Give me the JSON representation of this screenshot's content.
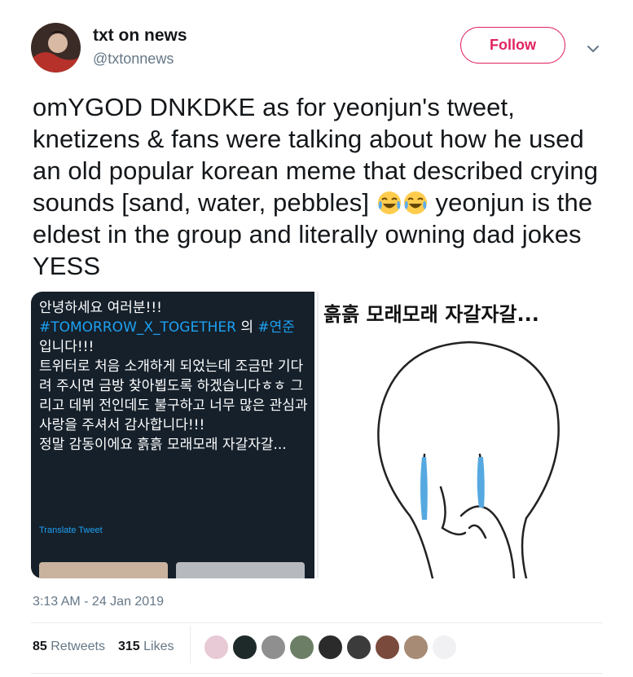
{
  "user": {
    "display_name": "txt on news",
    "handle": "@txtonnews",
    "avatar_colors": [
      "#3b2b26",
      "#d8b9a4",
      "#b5312a"
    ]
  },
  "follow_label": "Follow",
  "tweet": {
    "text_before_emoji": "omYGOD DNKDKE as for yeonjun's tweet, knetizens & fans were talking about how he used an old popular korean meme that described crying sounds [sand, water, pebbles] ",
    "emojis": [
      "face-with-tears-of-joy-icon",
      "face-with-tears-of-joy-icon"
    ],
    "text_after_emoji": " yeonjun is the eldest in the group and literally owning dad jokes YESS"
  },
  "embedded_tweet": {
    "line1": "안녕하세요 여러분!!!",
    "hashtag1": "#TOMORROW_X_TOGETHER",
    "joiner": " 의 ",
    "hashtag2": "#연준",
    "body": "입니다!!!\n트위터로 처음 소개하게 되었는데 조금만 기다려 주시면 금방 찾아뵙도록 하겠습니다ㅎㅎ 그리고 데뷔 전인데도 불구하고 너무 많은 관심과 사랑을 주셔서 감사합니다!!!\n정말 감동이에요 흙흙 모래모래 자갈자갈...",
    "translate_label": "Translate Tweet"
  },
  "meme": {
    "caption": "흙흙 모래모래 자갈자갈..."
  },
  "timestamp": "3:13 AM - 24 Jan 2019",
  "stats": {
    "retweets_count": "85",
    "retweets_label": "Retweets",
    "likes_count": "315",
    "likes_label": "Likes"
  },
  "likers": [
    {
      "name": "liker-avatar-1",
      "color": "#e8c9d6"
    },
    {
      "name": "liker-avatar-2",
      "color": "#1e2a2a"
    },
    {
      "name": "liker-avatar-3",
      "color": "#8f8f8f"
    },
    {
      "name": "liker-avatar-4",
      "color": "#6c7f66"
    },
    {
      "name": "liker-avatar-5",
      "color": "#2b2b2b"
    },
    {
      "name": "liker-avatar-6",
      "color": "#3b3b3b"
    },
    {
      "name": "liker-avatar-7",
      "color": "#7a4a3c"
    },
    {
      "name": "liker-avatar-8",
      "color": "#a88b74"
    },
    {
      "name": "liker-avatar-9",
      "color": "#f1f1f4"
    }
  ],
  "colors": {
    "accent": "#e0245e",
    "link": "#1da1f2",
    "muted": "#657786",
    "tear": "#56a9e0"
  }
}
